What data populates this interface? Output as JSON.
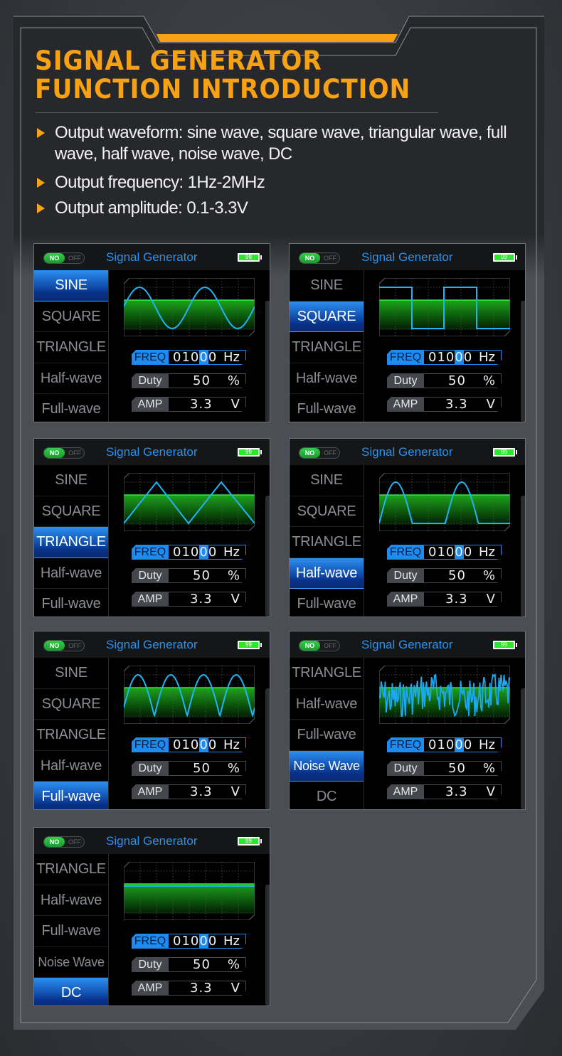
{
  "colors": {
    "accent": "#f7a114",
    "screen_blue": "#1e8bf0",
    "wave": "#22b4f2",
    "grid_green": "#1bbd1b",
    "battery_green": "#2ce82c"
  },
  "title": {
    "line1": "SIGNAL GENERATOR",
    "line2": "FUNCTION INTRODUCTION"
  },
  "bullets": [
    {
      "icon": "triangle-bullet-icon",
      "text": "Output waveform: sine wave, square wave, triangular wave, full wave, half wave, noise wave, DC"
    },
    {
      "icon": "triangle-bullet-icon",
      "text": "Output frequency: 1Hz-2MHz"
    },
    {
      "icon": "triangle-bullet-icon",
      "text": "Output amplitude: 0.1-3.3V"
    }
  ],
  "screens": [
    {
      "id": "sine",
      "menu": [
        "SINE",
        "SQUARE",
        "TRIANGLE",
        "Half-wave",
        "Full-wave"
      ],
      "selected": 0,
      "waveform": "sine"
    },
    {
      "id": "square",
      "menu": [
        "SINE",
        "SQUARE",
        "TRIANGLE",
        "Half-wave",
        "Full-wave"
      ],
      "selected": 1,
      "waveform": "square"
    },
    {
      "id": "triangle",
      "menu": [
        "SINE",
        "SQUARE",
        "TRIANGLE",
        "Half-wave",
        "Full-wave"
      ],
      "selected": 2,
      "waveform": "triangle"
    },
    {
      "id": "half-wave",
      "menu": [
        "SINE",
        "SQUARE",
        "TRIANGLE",
        "Half-wave",
        "Full-wave"
      ],
      "selected": 3,
      "waveform": "half"
    },
    {
      "id": "full-wave",
      "menu": [
        "SINE",
        "SQUARE",
        "TRIANGLE",
        "Half-wave",
        "Full-wave"
      ],
      "selected": 4,
      "waveform": "full"
    },
    {
      "id": "noise",
      "menu": [
        "TRIANGLE",
        "Half-wave",
        "Full-wave",
        "Noise Wave",
        "DC"
      ],
      "selected": 3,
      "waveform": "noise"
    },
    {
      "id": "dc",
      "menu": [
        "TRIANGLE",
        "Half-wave",
        "Full-wave",
        "Noise Wave",
        "DC"
      ],
      "selected": 4,
      "waveform": "dc"
    }
  ],
  "screen_common": {
    "toggle_on": "NO",
    "toggle_off": "OFF",
    "header_title": "Signal Generator",
    "battery": "99",
    "freq": {
      "label": "FREQ",
      "digits_before": "010",
      "digit_highlight": "0",
      "digits_after": "0",
      "unit": "Hz"
    },
    "duty": {
      "label": "Duty",
      "value": "50",
      "unit": "%"
    },
    "amp": {
      "label": "AMP",
      "value": "3.3",
      "unit": "V"
    }
  }
}
